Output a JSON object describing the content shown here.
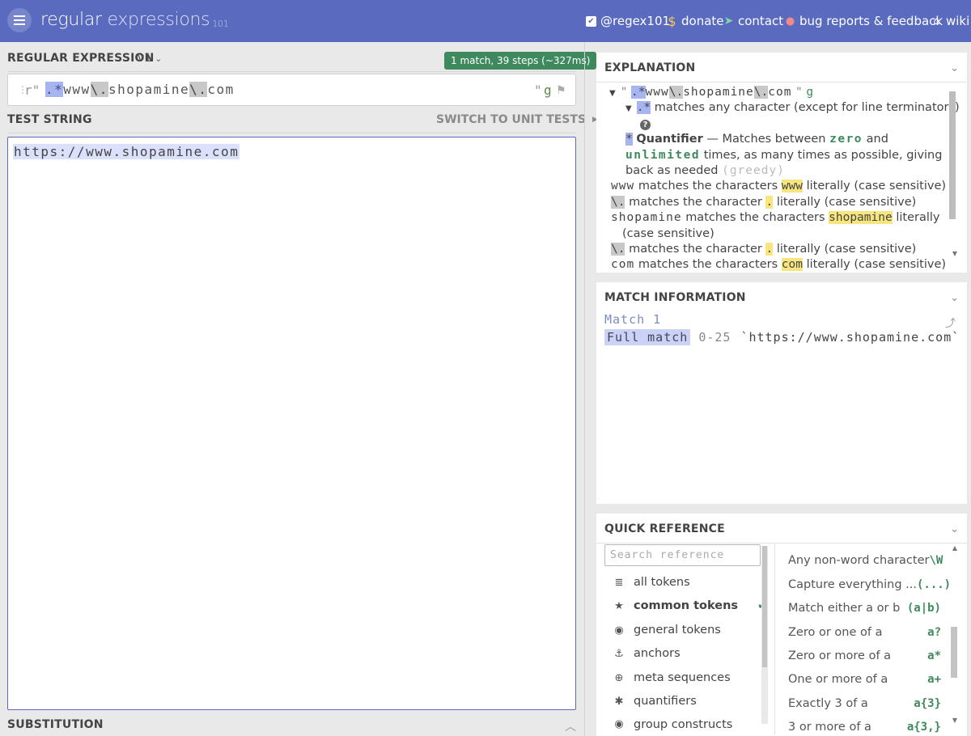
{
  "header": {
    "logo_main": "regular",
    "logo_sub": " expressions",
    "logo_ver": "101",
    "links": [
      {
        "label": "@regex101",
        "icon": "twitter-icon"
      },
      {
        "label": "donate",
        "icon": "dollar-icon"
      },
      {
        "label": "contact",
        "icon": "paper-plane-icon"
      },
      {
        "label": "bug reports & feedback",
        "icon": "github-icon"
      },
      {
        "label": "wiki",
        "icon": "bank-icon"
      }
    ]
  },
  "regex": {
    "title": "REGULAR EXPRESSION",
    "version": "v1",
    "stats": "1 match, 39 steps (~327ms)",
    "delim_open": "r\"",
    "tokens": [
      ".*",
      "www",
      "\\.",
      "shopamine",
      "\\.",
      "com"
    ],
    "delim_close": "\"",
    "flags": "g"
  },
  "test": {
    "title": "TEST STRING",
    "switch_label": "SWITCH TO UNIT TESTS",
    "value": "https://www.shopamine.com"
  },
  "substitution": {
    "title": "SUBSTITUTION"
  },
  "explanation": {
    "title": "EXPLANATION",
    "l1_q1": "\"",
    "l1_dot": ".*",
    "l1_rest": "www",
    "l1_esc1": "\\.",
    "l1_shop": "shopamine",
    "l1_esc2": "\\.",
    "l1_com": "com",
    "l1_q2": "\"",
    "l1_flag": "g",
    "l2_tok": ".*",
    "l2_text": "matches any character (except for line terminators)",
    "l3_help": "?",
    "l4_tok": "*",
    "l4_bold": "Quantifier",
    "l4_text": "— Matches between",
    "l4_zero": "zero",
    "l4_and": "and",
    "l5_unl": "unlimited",
    "l5_text": "times, as many times as possible, giving",
    "l6_text": "back as needed",
    "l6_greedy": "(greedy)",
    "l7_tok": "www",
    "l7_text": "matches the characters",
    "l7_hl": "www",
    "l7_end": "literally (case sensitive)",
    "l8_tok": "\\.",
    "l8_text": "matches the character",
    "l8_hl": ".",
    "l8_end": "literally (case sensitive)",
    "l9_tok": "shopamine",
    "l9_text": "matches the characters",
    "l9_hl": "shopamine",
    "l9_end": "literally",
    "l10_text": "(case sensitive)",
    "l11_tok": "\\.",
    "l11_text": "matches the character",
    "l11_hl": ".",
    "l11_end": "literally (case sensitive)",
    "l12_tok": "com",
    "l12_text": "matches the characters",
    "l12_hl": "com",
    "l12_end": "literally (case sensitive)"
  },
  "match_info": {
    "title": "MATCH INFORMATION",
    "match_label": "Match 1",
    "full_label": "Full match",
    "range": "0-25",
    "value": "`https://www.shopamine.com`"
  },
  "quick_ref": {
    "title": "QUICK REFERENCE",
    "search_placeholder": "Search reference",
    "categories": [
      {
        "label": "all tokens",
        "icon": "database-icon"
      },
      {
        "label": "common tokens",
        "icon": "star-icon"
      },
      {
        "label": "general tokens",
        "icon": "circle-dot-icon"
      },
      {
        "label": "anchors",
        "icon": "anchor-icon"
      },
      {
        "label": "meta sequences",
        "icon": "life-ring-icon"
      },
      {
        "label": "quantifiers",
        "icon": "asterisk-icon"
      },
      {
        "label": "group constructs",
        "icon": "circle-dot-icon"
      }
    ],
    "refs": [
      {
        "desc": "Any non-word character",
        "token": "\\W"
      },
      {
        "desc": "Capture everything ...",
        "token": "(...)"
      },
      {
        "desc": "Match either a or b",
        "token": "(a|b)"
      },
      {
        "desc": "Zero or one of a",
        "token": "a?"
      },
      {
        "desc": "Zero or more of a",
        "token": "a*"
      },
      {
        "desc": "One or more of a",
        "token": "a+"
      },
      {
        "desc": "Exactly 3 of a",
        "token": "a{3}"
      },
      {
        "desc": "3 or more of a",
        "token": "a{3,}"
      }
    ]
  },
  "colors": {
    "header": "#5a6bbf",
    "accent_green": "#3e8a5e",
    "token_blue": "#a6b4f0",
    "literal_yellow": "#f7e67e"
  }
}
